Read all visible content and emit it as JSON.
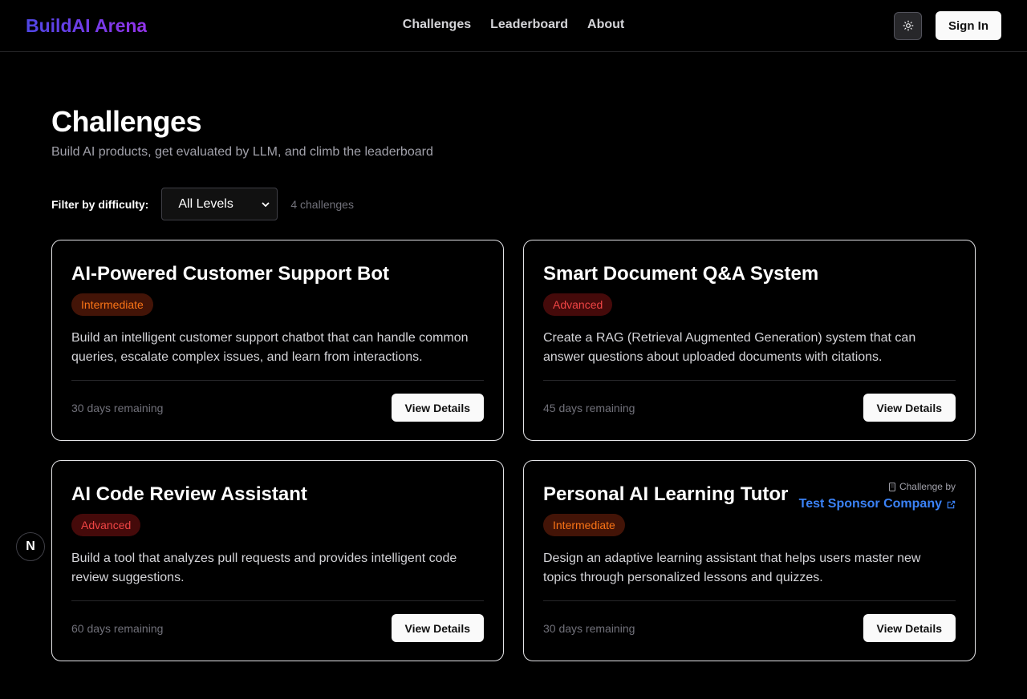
{
  "header": {
    "brand": "BuildAI Arena",
    "nav": [
      {
        "label": "Challenges"
      },
      {
        "label": "Leaderboard"
      },
      {
        "label": "About"
      }
    ],
    "theme_icon": "sun-icon",
    "signin_label": "Sign In"
  },
  "page": {
    "title": "Challenges",
    "subtitle": "Build AI products, get evaluated by LLM, and climb the leaderboard"
  },
  "filter": {
    "label": "Filter by difficulty:",
    "selected": "All Levels",
    "count": "4 challenges"
  },
  "challenges": [
    {
      "title": "AI-Powered Customer Support Bot",
      "difficulty": "Intermediate",
      "description": "Build an intelligent customer support chatbot that can handle common queries, escalate complex issues, and learn from interactions.",
      "remaining": "30 days remaining",
      "button": "View Details"
    },
    {
      "title": "Smart Document Q&A System",
      "difficulty": "Advanced",
      "description": "Create a RAG (Retrieval Augmented Generation) system that can answer questions about uploaded documents with citations.",
      "remaining": "45 days remaining",
      "button": "View Details"
    },
    {
      "title": "AI Code Review Assistant",
      "difficulty": "Advanced",
      "description": "Build a tool that analyzes pull requests and provides intelligent code review suggestions.",
      "remaining": "60 days remaining",
      "button": "View Details"
    },
    {
      "title": "Personal AI Learning Tutor",
      "difficulty": "Intermediate",
      "description": "Design an adaptive learning assistant that helps users master new topics through personalized lessons and quizzes.",
      "remaining": "30 days remaining",
      "button": "View Details",
      "sponsor_label": "Challenge by",
      "sponsor_name": "Test Sponsor Company"
    }
  ],
  "dev_badge": "N"
}
